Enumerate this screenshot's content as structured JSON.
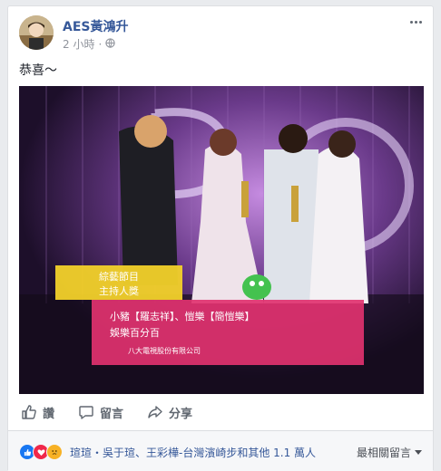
{
  "post": {
    "author": "AES黃鴻升",
    "timestamp": "2 小時",
    "privacy_icon": "globe-icon",
    "text": "恭喜～"
  },
  "photo": {
    "caption_category": [
      "綜藝節目",
      "主持人獎"
    ],
    "winners_line": "小豬【羅志祥】、愷樂【簡愷樂】",
    "program": "娛樂百分百",
    "company": "八大電視股份有限公司"
  },
  "actions": {
    "like": "讚",
    "comment": "留言",
    "share": "分享"
  },
  "footer": {
    "reactions": [
      "like-reaction-icon",
      "love-reaction-icon",
      "sad-reaction-icon"
    ],
    "likers": "瑄瑄・吳于瑄、王彩樺-台灣濱崎步和其他 1.1 萬人",
    "sort": "最相關留言"
  },
  "colors": {
    "link": "#365899",
    "like_blue": "#1877f2",
    "love_red": "#f0284a",
    "sad_yellow": "#f7b125"
  }
}
